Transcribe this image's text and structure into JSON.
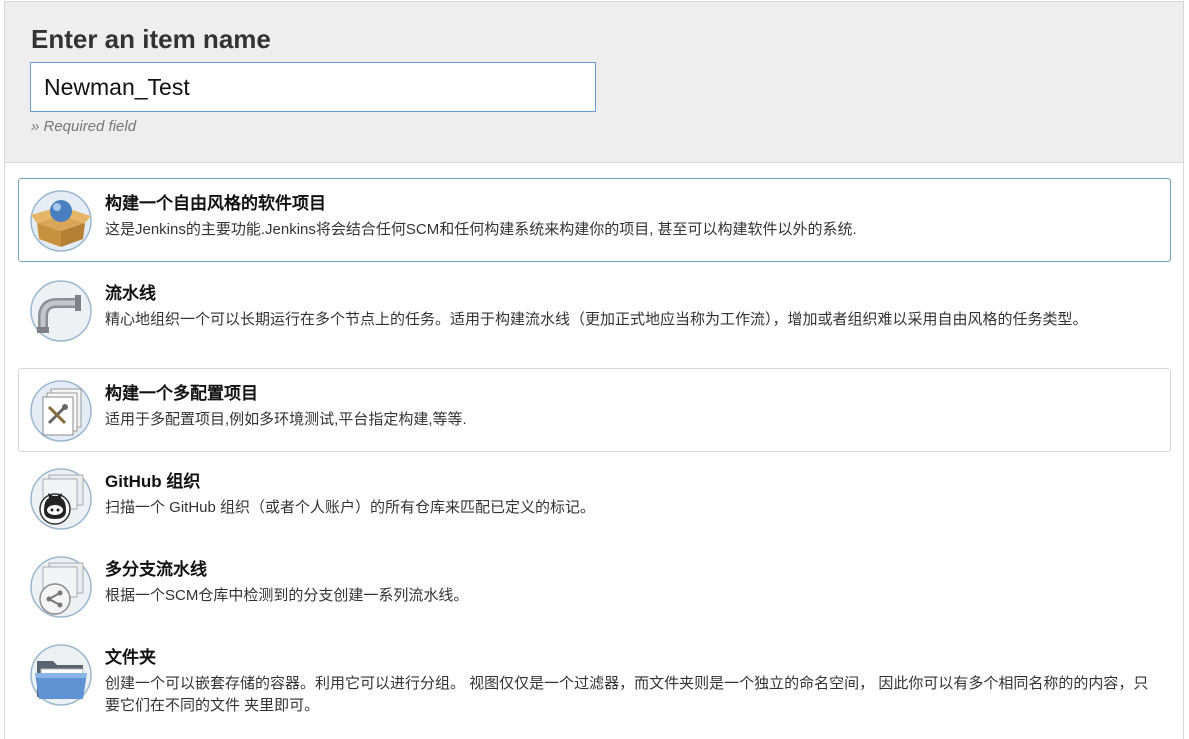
{
  "header": {
    "title": "Enter an item name",
    "input_value": "Newman_Test",
    "required_hint": "» Required field"
  },
  "items": [
    {
      "icon": "freestyle-package-icon",
      "title": "构建一个自由风格的软件项目",
      "description": "这是Jenkins的主要功能.Jenkins将会结合任何SCM和任何构建系统来构建你的项目, 甚至可以构建软件以外的系统."
    },
    {
      "icon": "pipeline-icon",
      "title": "流水线",
      "description": "精心地组织一个可以长期运行在多个节点上的任务。适用于构建流水线（更加正式地应当称为工作流），增加或者组织难以采用自由风格的任务类型。"
    },
    {
      "icon": "multi-config-icon",
      "title": "构建一个多配置项目",
      "description": "适用于多配置项目,例如多环境测试,平台指定构建,等等."
    },
    {
      "icon": "github-organization-icon",
      "title": "GitHub 组织",
      "description": "扫描一个 GitHub 组织（或者个人账户）的所有仓库来匹配已定义的标记。"
    },
    {
      "icon": "multibranch-pipeline-icon",
      "title": "多分支流水线",
      "description": "根据一个SCM仓库中检测到的分支创建一系列流水线。"
    },
    {
      "icon": "folder-icon",
      "title": "文件夹",
      "description": "创建一个可以嵌套存储的容器。利用它可以进行分组。 视图仅仅是一个过滤器，而文件夹则是一个独立的命名空间， 因此你可以有多个相同名称的的内容，只要它们在不同的文件 夹里即可。"
    }
  ],
  "colors": {
    "header_bg": "#eeeeee",
    "input_border": "#6d99d6",
    "selected_border": "#7aa1c5"
  }
}
